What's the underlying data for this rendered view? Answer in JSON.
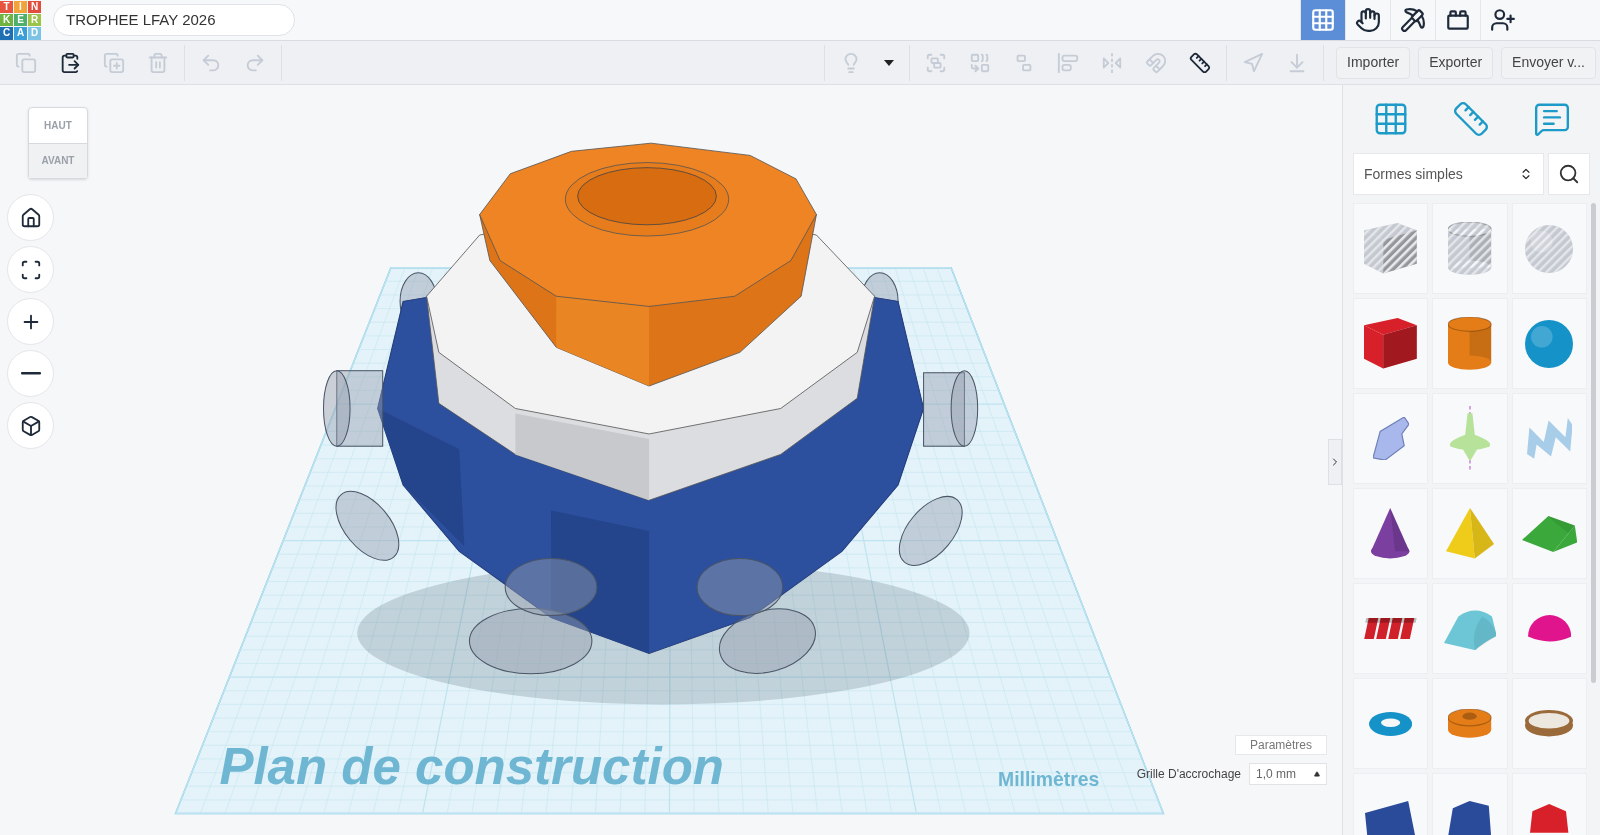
{
  "logo": {
    "letters": [
      {
        "char": "T",
        "color": "#e8553d"
      },
      {
        "char": "I",
        "color": "#f2a33a"
      },
      {
        "char": "N",
        "color": "#e24d3d"
      },
      {
        "char": "K",
        "color": "#6eb43f"
      },
      {
        "char": "E",
        "color": "#4fb06b"
      },
      {
        "char": "R",
        "color": "#9cc44a"
      },
      {
        "char": "C",
        "color": "#1f6fb4"
      },
      {
        "char": "A",
        "color": "#3a9fd9"
      },
      {
        "char": "D",
        "color": "#7cc3e6"
      }
    ]
  },
  "project_title": "TROPHEE LFAY 2026",
  "top_nav": [
    {
      "kind": "grid",
      "selected": true
    },
    {
      "kind": "hand",
      "selected": false
    },
    {
      "kind": "pickaxe",
      "selected": false
    },
    {
      "kind": "brick",
      "selected": false
    },
    {
      "kind": "user-add",
      "selected": false
    }
  ],
  "toolbar": {
    "edit_tools": [
      {
        "kind": "copy",
        "disabled": true
      },
      {
        "kind": "paste",
        "disabled": false
      },
      {
        "kind": "duplicate",
        "disabled": true
      },
      {
        "kind": "delete",
        "disabled": true
      }
    ],
    "history_tools": [
      {
        "kind": "undo",
        "disabled": true
      },
      {
        "kind": "redo",
        "disabled": true
      }
    ],
    "view_tools": [
      {
        "kind": "lightbulb",
        "disabled": true
      },
      {
        "kind": "caret",
        "disabled": false
      }
    ],
    "shape_tools": [
      {
        "kind": "group",
        "disabled": true
      },
      {
        "kind": "combine",
        "disabled": true
      },
      {
        "kind": "ungroup",
        "disabled": true
      },
      {
        "kind": "align",
        "disabled": true
      },
      {
        "kind": "mirror",
        "disabled": true
      },
      {
        "kind": "magnet",
        "disabled": true
      },
      {
        "kind": "ruler",
        "disabled": false
      }
    ],
    "place_tools": [
      {
        "kind": "cruise",
        "disabled": true
      },
      {
        "kind": "drop",
        "disabled": true
      }
    ],
    "buttons": [
      "Importer",
      "Exporter",
      "Envoyer v..."
    ]
  },
  "view_cube": {
    "top": "HAUT",
    "front": "AVANT"
  },
  "nav_buttons": [
    {
      "kind": "home"
    },
    {
      "kind": "fit"
    },
    {
      "kind": "zoom-in"
    },
    {
      "kind": "zoom-out"
    },
    {
      "kind": "perspective"
    }
  ],
  "workplane": {
    "title": "Plan de construction",
    "units": "Millimètres"
  },
  "settings_button": "Paramètres",
  "snap_grid": {
    "label": "Grille D'accrochage",
    "value": "1,0 mm"
  },
  "panel": {
    "tabs": [
      {
        "kind": "workplane"
      },
      {
        "kind": "ruler"
      },
      {
        "kind": "notes"
      }
    ],
    "category": "Formes simples",
    "shapes": [
      {
        "kind": "box",
        "color": "#c4c8d0",
        "hole": true
      },
      {
        "kind": "cylinder",
        "color": "#c4c8d0",
        "hole": true
      },
      {
        "kind": "sphere",
        "color": "#c4c8d0",
        "hole": true
      },
      {
        "kind": "box",
        "color": "#d8202a",
        "hole": false
      },
      {
        "kind": "cylinder",
        "color": "#e47d17",
        "hole": false
      },
      {
        "kind": "sphere",
        "color": "#1592c8",
        "hole": false
      },
      {
        "kind": "scribble",
        "color": "#a9b8ec",
        "hole": false
      },
      {
        "kind": "top",
        "color": "#b6e29a",
        "hole": false
      },
      {
        "kind": "zigzag",
        "color": "#a8cde8",
        "hole": false
      },
      {
        "kind": "cone",
        "color": "#7b3fa0",
        "hole": false
      },
      {
        "kind": "pyramid",
        "color": "#f0cc1a",
        "hole": false
      },
      {
        "kind": "roof",
        "color": "#3aa83a",
        "hole": false
      },
      {
        "kind": "text",
        "color": "#d0202a",
        "hole": false
      },
      {
        "kind": "round-roof",
        "color": "#6cc6d6",
        "hole": false
      },
      {
        "kind": "half-sphere",
        "color": "#e0148c",
        "hole": false
      },
      {
        "kind": "torus",
        "color": "#1592c8",
        "hole": false
      },
      {
        "kind": "tube",
        "color": "#e47d17",
        "hole": false
      },
      {
        "kind": "ring",
        "color": "#9a6a3a",
        "hole": false
      },
      {
        "kind": "wedge",
        "color": "#2a4a9a",
        "hole": false
      },
      {
        "kind": "polygon",
        "color": "#2a4a9a",
        "hole": false
      },
      {
        "kind": "gem",
        "color": "#d8202a",
        "hole": false
      }
    ]
  }
}
